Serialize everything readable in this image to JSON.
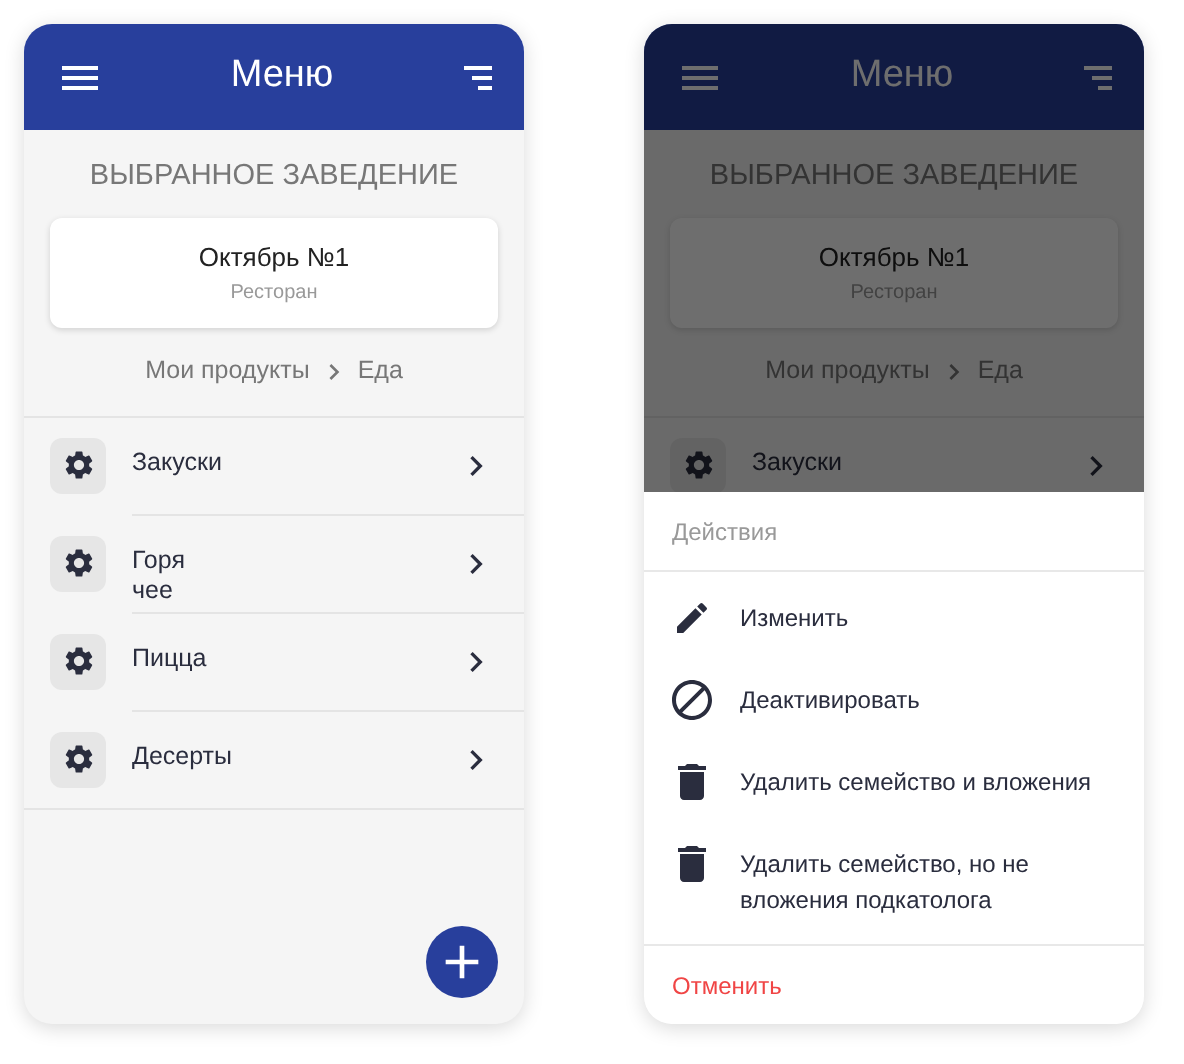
{
  "screens": [
    {
      "dimmed": false,
      "header": {
        "title": "Меню"
      },
      "section_title": "ВЫБРАННОЕ ЗАВЕДЕНИЕ",
      "venue": {
        "name": "Октябрь №1",
        "type": "Ресторан"
      },
      "breadcrumb": [
        "Мои продукты",
        "Еда"
      ],
      "categories": [
        {
          "label": "Закуски"
        },
        {
          "label": "Горя\nчее"
        },
        {
          "label": "Пицца"
        },
        {
          "label": "Десерты"
        }
      ]
    },
    {
      "dimmed": true,
      "header": {
        "title": "Меню"
      },
      "section_title": "ВЫБРАННОЕ ЗАВЕДЕНИЕ",
      "venue": {
        "name": "Октябрь №1",
        "type": "Ресторан"
      },
      "breadcrumb": [
        "Мои продукты",
        "Еда"
      ],
      "categories": [
        {
          "label": "Закуски"
        }
      ],
      "action_sheet": {
        "title": "Действия",
        "actions": [
          {
            "kind": "edit",
            "label": "Изменить"
          },
          {
            "kind": "deactivate",
            "label": "Деактивировать"
          },
          {
            "kind": "delete",
            "label": "Удалить семейство и вложения"
          },
          {
            "kind": "delete",
            "label": "Удалить семейство, но не вложения подкатолога"
          }
        ],
        "cancel": "Отменить"
      }
    }
  ]
}
